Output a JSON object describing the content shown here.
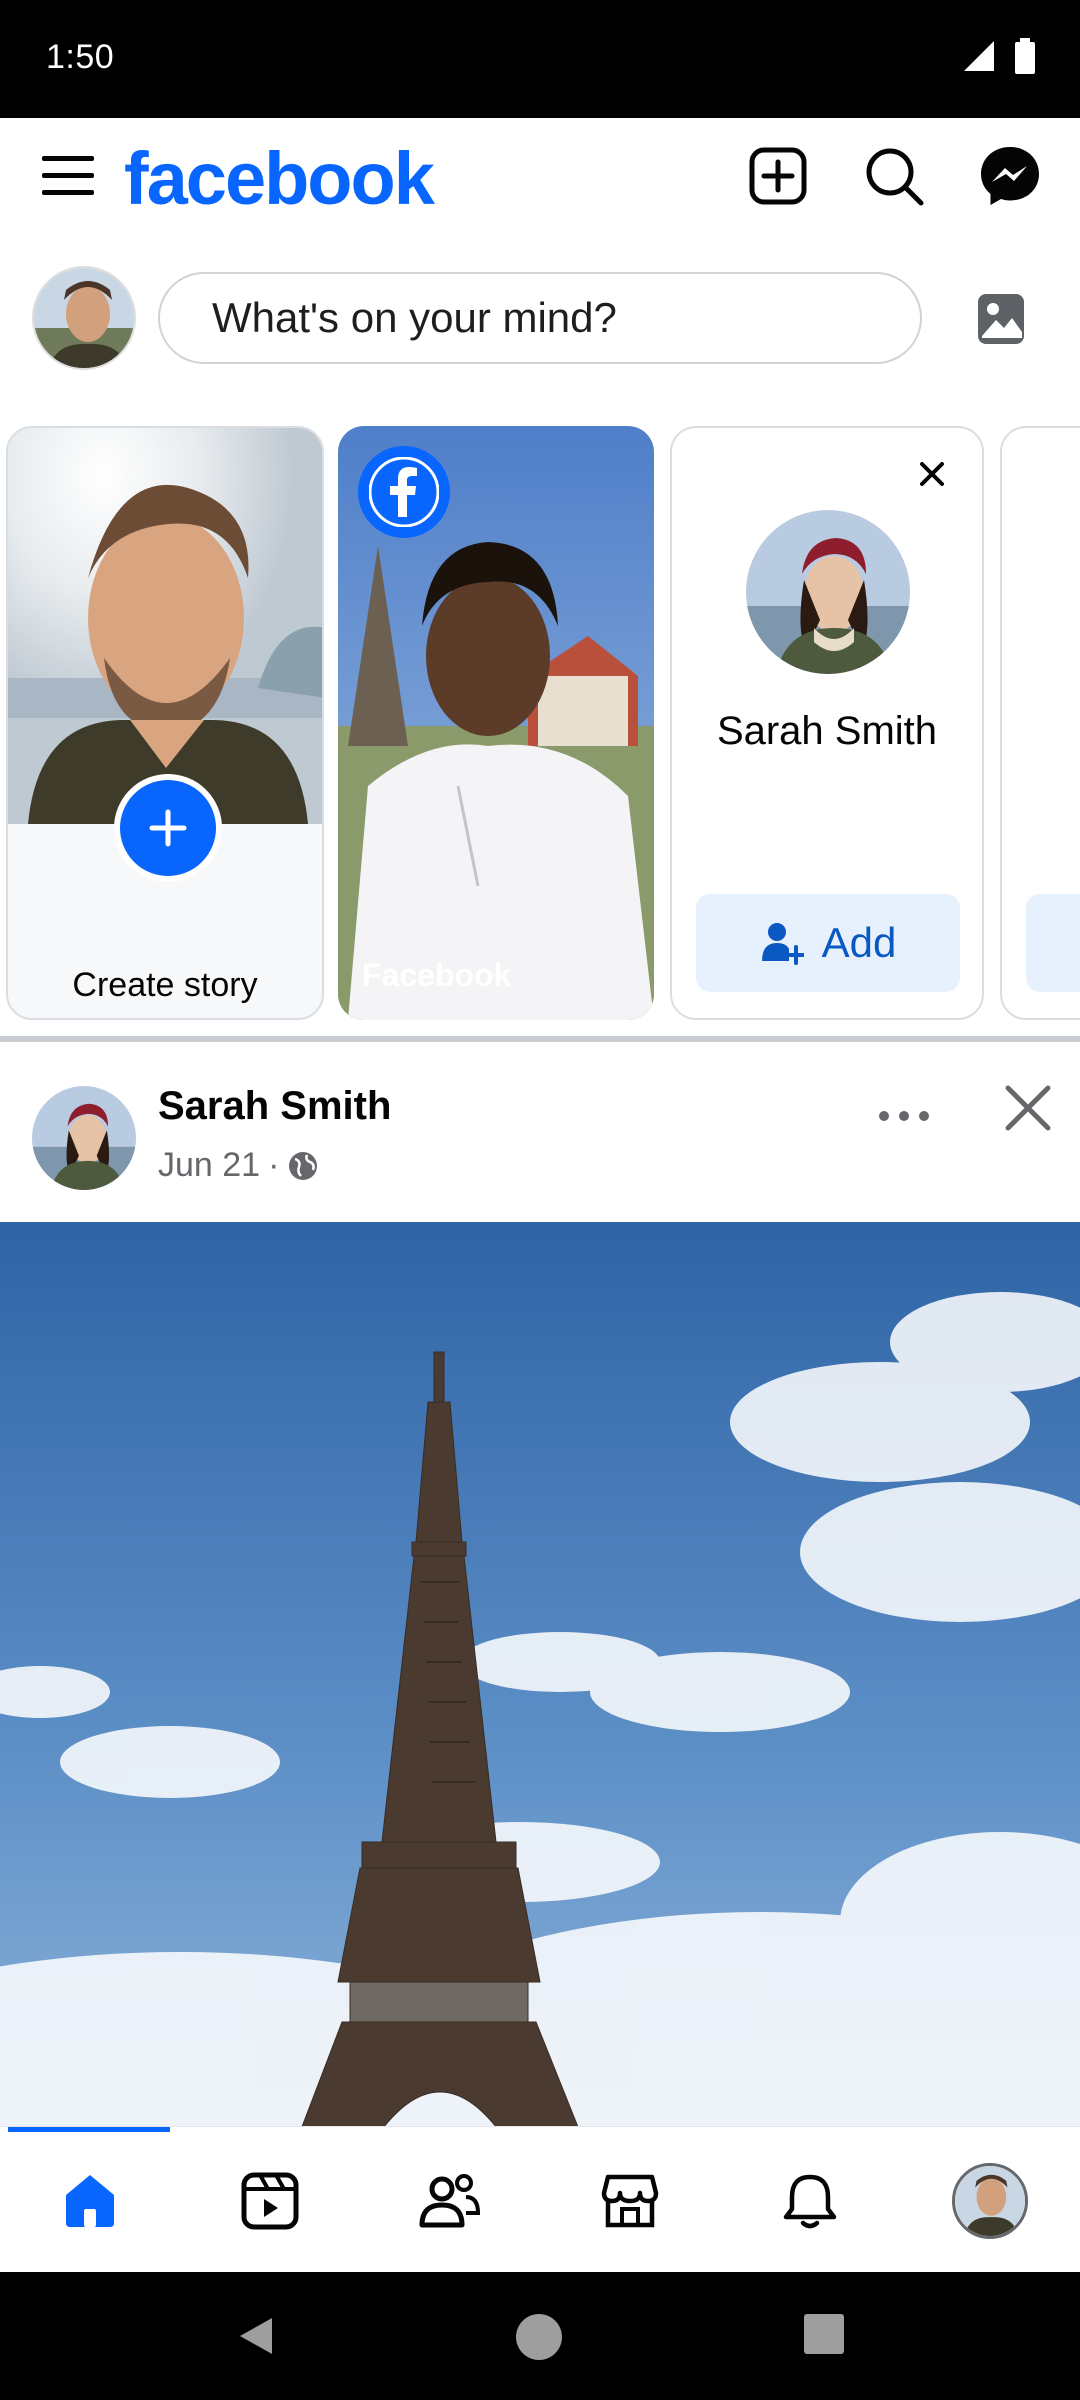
{
  "status_bar": {
    "time": "1:50"
  },
  "header": {
    "logo": "facebook"
  },
  "composer": {
    "placeholder": "What's on your mind?"
  },
  "stories": {
    "create_label": "Create story",
    "facebook_story_label": "Facebook",
    "suggestion": {
      "name": "Sarah Smith",
      "add_label": "Add"
    }
  },
  "post": {
    "author": "Sarah Smith",
    "date": "Jun 21",
    "separator": "·",
    "privacy_icon": "globe-icon"
  },
  "colors": {
    "brand": "#0866ff",
    "add_bg": "#e7f0fd",
    "meta": "#65676b"
  },
  "bottom_nav": {
    "items": [
      "home-icon",
      "video-icon",
      "friends-icon",
      "marketplace-icon",
      "notifications-icon",
      "profile-avatar"
    ],
    "active": "home-icon"
  }
}
